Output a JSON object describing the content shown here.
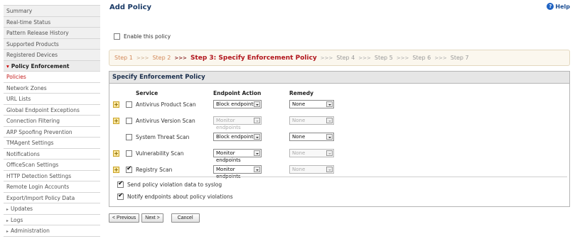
{
  "sidebar": {
    "top_items": [
      "Summary",
      "Real-time Status",
      "Pattern Release History",
      "Supported Products",
      "Registered Devices"
    ],
    "section": "Policy Enforcement",
    "sub_items": [
      "Policies",
      "Network Zones",
      "URL Lists",
      "Global Endpoint Exceptions",
      "Connection Filtering",
      "ARP Spoofing Prevention",
      "TMAgent Settings",
      "Notifications",
      "OfficeScan Settings",
      "HTTP Detection Settings",
      "Remote Login Accounts",
      "Export/Import Policy Data"
    ],
    "active_sub": "Policies",
    "collapsed_items": [
      "Updates",
      "Logs",
      "Administration"
    ]
  },
  "header": {
    "title": "Add Policy",
    "help_label": "Help"
  },
  "enable_label": "Enable this policy",
  "steps": {
    "items": [
      "Step 1",
      "Step 2",
      "Step 3: Specify Enforcement Policy",
      "Step 4",
      "Step 5",
      "Step 6",
      "Step 7"
    ],
    "separator": ">>>",
    "current_index": 2
  },
  "panel": {
    "title": "Specify Enforcement Policy",
    "columns": {
      "service": "Service",
      "endpoint_action": "Endpoint Action",
      "remedy": "Remedy"
    },
    "rows": [
      {
        "service": "Antivirus Product Scan",
        "checked": false,
        "expandable": true,
        "action": "Block endpoints",
        "action_enabled": true,
        "remedy": "None",
        "remedy_enabled": true
      },
      {
        "service": "Antivirus Version Scan",
        "checked": false,
        "expandable": true,
        "action": "Monitor endpoints",
        "action_enabled": false,
        "remedy": "None",
        "remedy_enabled": false
      },
      {
        "service": "System Threat Scan",
        "checked": false,
        "expandable": false,
        "action": "Block endpoints",
        "action_enabled": true,
        "remedy": "None",
        "remedy_enabled": true
      },
      {
        "service": "Vulnerability Scan",
        "checked": false,
        "expandable": true,
        "action": "Monitor endpoints",
        "action_enabled": true,
        "remedy": "None",
        "remedy_enabled": false
      },
      {
        "service": "Registry Scan",
        "checked": true,
        "expandable": true,
        "action": "Monitor endpoints",
        "action_enabled": true,
        "remedy": "None",
        "remedy_enabled": false
      }
    ],
    "options": [
      {
        "label": "Send policy violation data to syslog",
        "checked": true
      },
      {
        "label": "Notify endpoints about policy violations",
        "checked": true
      }
    ]
  },
  "buttons": {
    "previous": "< Previous",
    "next": "Next >",
    "cancel": "Cancel"
  }
}
